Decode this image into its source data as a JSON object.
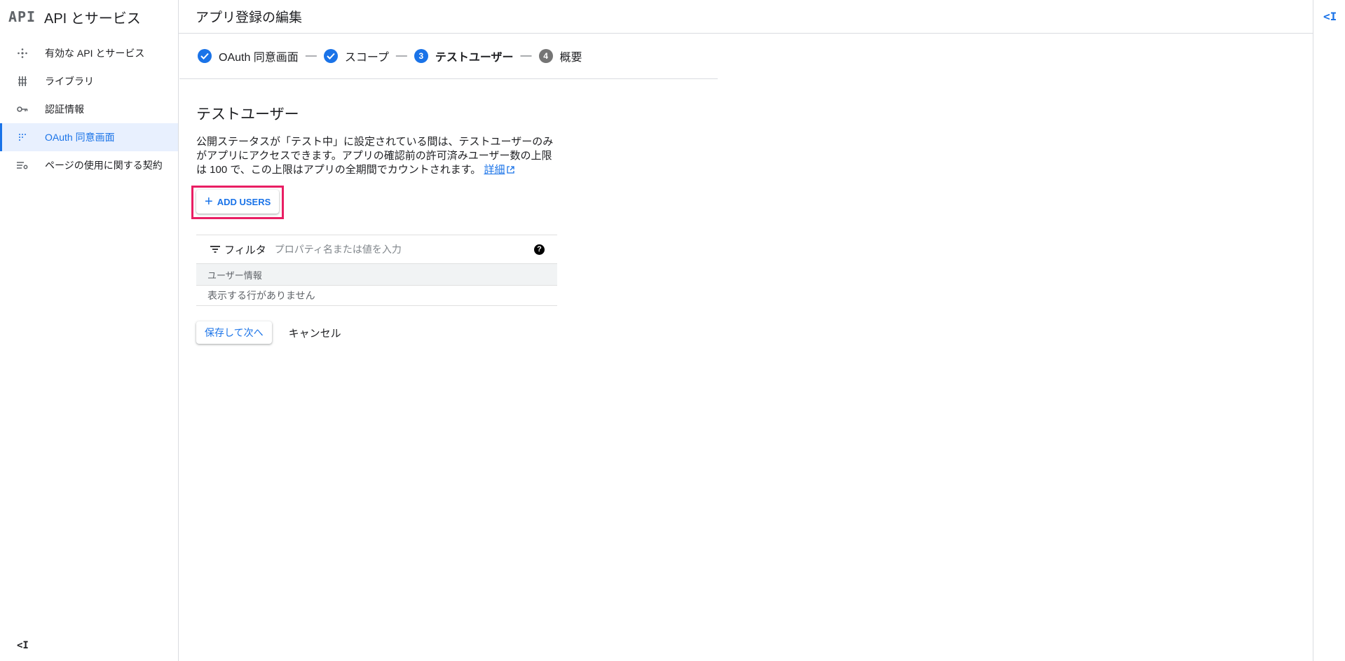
{
  "sidebar": {
    "logo": "API",
    "title": "API とサービス",
    "items": [
      {
        "label": "有効な API とサービス",
        "icon": "apis-hub-icon",
        "active": false
      },
      {
        "label": "ライブラリ",
        "icon": "library-icon",
        "active": false
      },
      {
        "label": "認証情報",
        "icon": "key-icon",
        "active": false
      },
      {
        "label": "OAuth 同意画面",
        "icon": "oauth-consent-icon",
        "active": true
      },
      {
        "label": "ページの使用に関する契約",
        "icon": "settings-list-icon",
        "active": false
      }
    ],
    "collapse_label": "<I"
  },
  "header": {
    "title": "アプリ登録の編集",
    "rail_label": "<I"
  },
  "stepper": {
    "steps": [
      {
        "number": "",
        "label": "OAuth 同意画面",
        "state": "done"
      },
      {
        "number": "",
        "label": "スコープ",
        "state": "done"
      },
      {
        "number": "3",
        "label": "テストユーザー",
        "state": "current"
      },
      {
        "number": "4",
        "label": "概要",
        "state": "pending"
      }
    ],
    "separator": "—"
  },
  "main": {
    "section_title": "テストユーザー",
    "description": "公開ステータスが「テスト中」に設定されている間は、テストユーザーのみがアプリにアクセスできます。アプリの確認前の許可済みユーザー数の上限は 100 で、この上限はアプリの全期間でカウントされます。",
    "details_link": "詳細",
    "add_users_label": "ADD USERS",
    "filter": {
      "label": "フィルタ",
      "placeholder": "プロパティ名または値を入力",
      "help": "?"
    },
    "table": {
      "column": "ユーザー情報",
      "empty": "表示する行がありません"
    },
    "save_label": "保存して次へ",
    "cancel_label": "キャンセル"
  },
  "colors": {
    "accent": "#1a73e8",
    "highlight": "#e91e63",
    "active_bg": "#e8f0fe"
  }
}
